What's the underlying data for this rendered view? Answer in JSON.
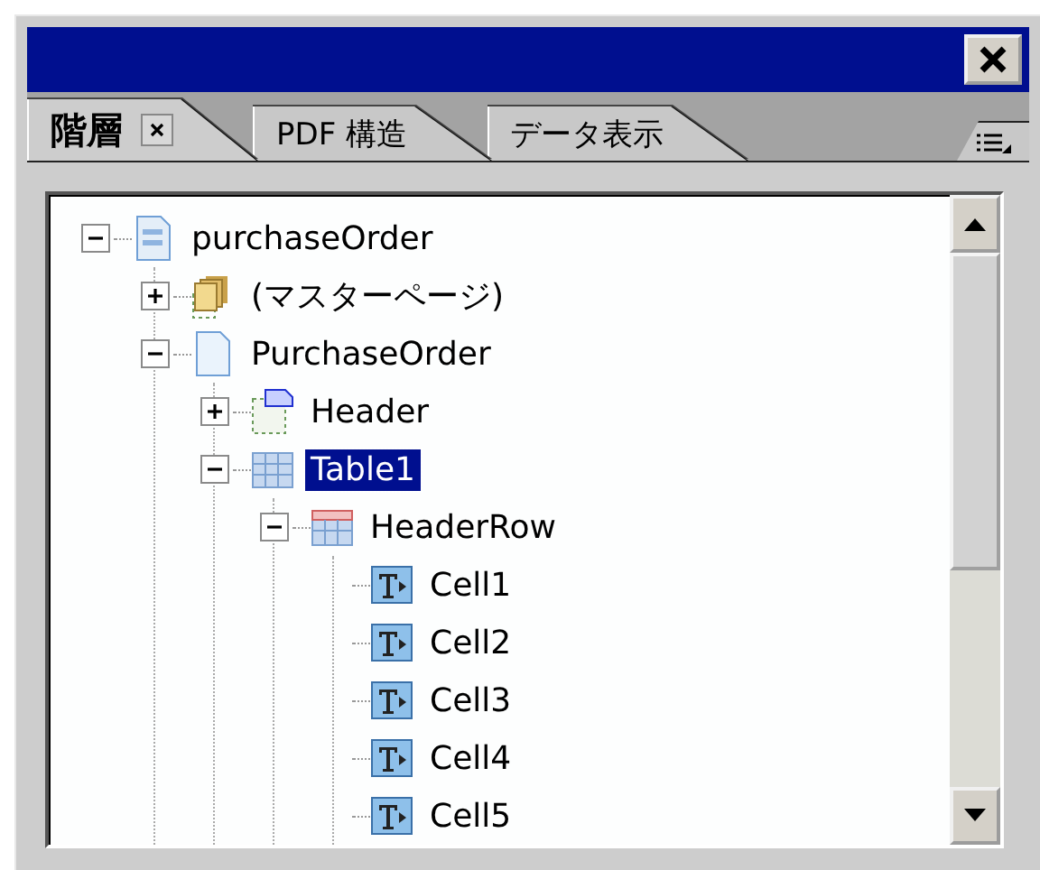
{
  "tabs": [
    {
      "label": "階層",
      "selected": true,
      "closable": true
    },
    {
      "label": "PDF 構造",
      "selected": false,
      "closable": false
    },
    {
      "label": "データ表示",
      "selected": false,
      "closable": false
    }
  ],
  "tree": [
    {
      "label": "purchaseOrder",
      "kind": "document",
      "expanded": true,
      "selected": false,
      "children": [
        {
          "label": "(マスターページ)",
          "kind": "master-pages",
          "expanded": false,
          "selected": false
        },
        {
          "label": "PurchaseOrder",
          "kind": "page",
          "expanded": true,
          "selected": false,
          "children": [
            {
              "label": "Header",
              "kind": "header",
              "expanded": false,
              "selected": false
            },
            {
              "label": "Table1",
              "kind": "table",
              "expanded": true,
              "selected": true,
              "children": [
                {
                  "label": "HeaderRow",
                  "kind": "row",
                  "expanded": true,
                  "selected": false,
                  "children": [
                    {
                      "label": "Cell1",
                      "kind": "text-cell",
                      "selected": false
                    },
                    {
                      "label": "Cell2",
                      "kind": "text-cell",
                      "selected": false
                    },
                    {
                      "label": "Cell3",
                      "kind": "text-cell",
                      "selected": false
                    },
                    {
                      "label": "Cell4",
                      "kind": "text-cell",
                      "selected": false
                    },
                    {
                      "label": "Cell5",
                      "kind": "text-cell",
                      "selected": false
                    }
                  ]
                }
              ]
            }
          ]
        }
      ]
    }
  ]
}
